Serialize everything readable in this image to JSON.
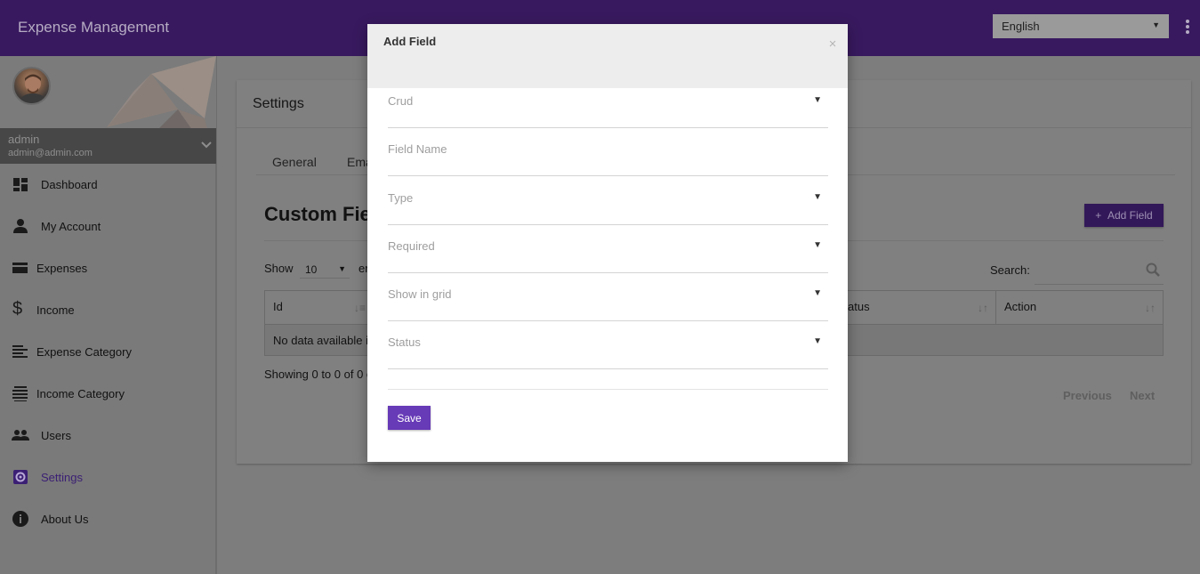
{
  "header": {
    "app_title": "Expense Management",
    "language": {
      "selected": "English"
    },
    "menu_icon": "kebab-vertical-icon"
  },
  "sidebar": {
    "profile": {
      "name": "admin",
      "email": "admin@admin.com"
    },
    "items": [
      {
        "label": "Dashboard",
        "icon": "dashboard-icon",
        "active": false
      },
      {
        "label": "My Account",
        "icon": "person-icon",
        "active": false
      },
      {
        "label": "Expenses",
        "icon": "card-icon",
        "active": false
      },
      {
        "label": "Income",
        "icon": "dollar-icon",
        "active": false
      },
      {
        "label": "Expense Category",
        "icon": "list-icon",
        "active": false
      },
      {
        "label": "Income Category",
        "icon": "list-stacked-icon",
        "active": false
      },
      {
        "label": "Users",
        "icon": "users-icon",
        "active": false
      },
      {
        "label": "Settings",
        "icon": "gear-icon",
        "active": true
      },
      {
        "label": "About Us",
        "icon": "info-icon",
        "active": false
      }
    ]
  },
  "main": {
    "card_title": "Settings",
    "tabs": [
      "General",
      "Ema"
    ],
    "section_title": "Custom Fie",
    "add_button": "Add Field",
    "table_controls": {
      "show_label": "Show",
      "page_size": "10",
      "entries_suffix": "er",
      "search_label": "Search:"
    },
    "table": {
      "columns": [
        "Id",
        "atus",
        "Action"
      ],
      "empty_text": "No data available i"
    },
    "info": "Showing 0 to 0 of 0 e",
    "pagination": {
      "previous": "Previous",
      "next": "Next"
    }
  },
  "modal": {
    "title": "Add Field",
    "close": "×",
    "fields": [
      {
        "label": "Crud",
        "type": "select"
      },
      {
        "label": "Field Name",
        "type": "text"
      },
      {
        "label": "Type",
        "type": "select"
      },
      {
        "label": "Required",
        "type": "select"
      },
      {
        "label": "Show in grid",
        "type": "select"
      },
      {
        "label": "Status",
        "type": "select"
      }
    ],
    "save": "Save"
  },
  "colors": {
    "primary": "#673ab7",
    "header_bg": "#38195f",
    "overlay_bg": "#7d7d7d"
  }
}
